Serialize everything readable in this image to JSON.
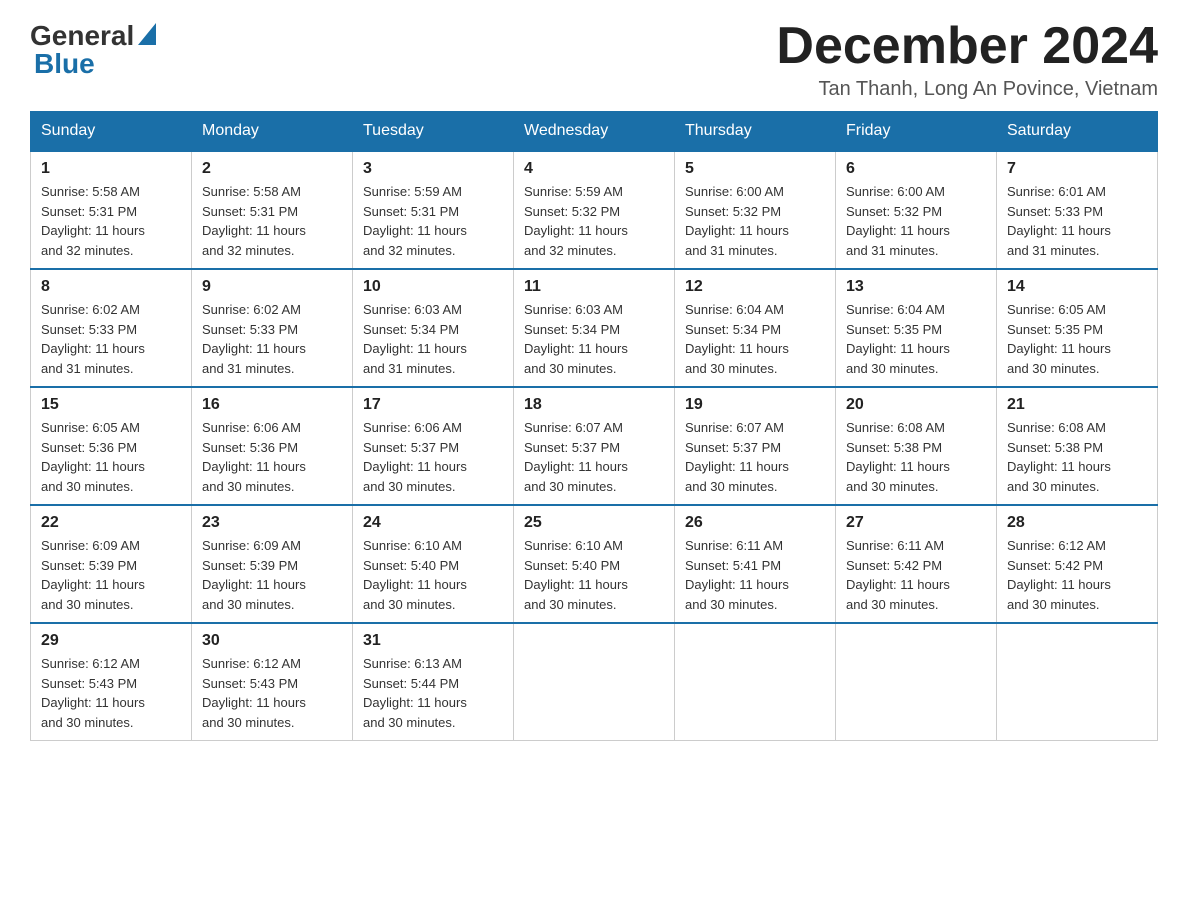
{
  "header": {
    "logo_general": "General",
    "logo_blue": "Blue",
    "month_title": "December 2024",
    "location": "Tan Thanh, Long An Povince, Vietnam"
  },
  "days_of_week": [
    "Sunday",
    "Monday",
    "Tuesday",
    "Wednesday",
    "Thursday",
    "Friday",
    "Saturday"
  ],
  "weeks": [
    [
      {
        "day": "1",
        "sunrise": "5:58 AM",
        "sunset": "5:31 PM",
        "daylight": "11 hours and 32 minutes."
      },
      {
        "day": "2",
        "sunrise": "5:58 AM",
        "sunset": "5:31 PM",
        "daylight": "11 hours and 32 minutes."
      },
      {
        "day": "3",
        "sunrise": "5:59 AM",
        "sunset": "5:31 PM",
        "daylight": "11 hours and 32 minutes."
      },
      {
        "day": "4",
        "sunrise": "5:59 AM",
        "sunset": "5:32 PM",
        "daylight": "11 hours and 32 minutes."
      },
      {
        "day": "5",
        "sunrise": "6:00 AM",
        "sunset": "5:32 PM",
        "daylight": "11 hours and 31 minutes."
      },
      {
        "day": "6",
        "sunrise": "6:00 AM",
        "sunset": "5:32 PM",
        "daylight": "11 hours and 31 minutes."
      },
      {
        "day": "7",
        "sunrise": "6:01 AM",
        "sunset": "5:33 PM",
        "daylight": "11 hours and 31 minutes."
      }
    ],
    [
      {
        "day": "8",
        "sunrise": "6:02 AM",
        "sunset": "5:33 PM",
        "daylight": "11 hours and 31 minutes."
      },
      {
        "day": "9",
        "sunrise": "6:02 AM",
        "sunset": "5:33 PM",
        "daylight": "11 hours and 31 minutes."
      },
      {
        "day": "10",
        "sunrise": "6:03 AM",
        "sunset": "5:34 PM",
        "daylight": "11 hours and 31 minutes."
      },
      {
        "day": "11",
        "sunrise": "6:03 AM",
        "sunset": "5:34 PM",
        "daylight": "11 hours and 30 minutes."
      },
      {
        "day": "12",
        "sunrise": "6:04 AM",
        "sunset": "5:34 PM",
        "daylight": "11 hours and 30 minutes."
      },
      {
        "day": "13",
        "sunrise": "6:04 AM",
        "sunset": "5:35 PM",
        "daylight": "11 hours and 30 minutes."
      },
      {
        "day": "14",
        "sunrise": "6:05 AM",
        "sunset": "5:35 PM",
        "daylight": "11 hours and 30 minutes."
      }
    ],
    [
      {
        "day": "15",
        "sunrise": "6:05 AM",
        "sunset": "5:36 PM",
        "daylight": "11 hours and 30 minutes."
      },
      {
        "day": "16",
        "sunrise": "6:06 AM",
        "sunset": "5:36 PM",
        "daylight": "11 hours and 30 minutes."
      },
      {
        "day": "17",
        "sunrise": "6:06 AM",
        "sunset": "5:37 PM",
        "daylight": "11 hours and 30 minutes."
      },
      {
        "day": "18",
        "sunrise": "6:07 AM",
        "sunset": "5:37 PM",
        "daylight": "11 hours and 30 minutes."
      },
      {
        "day": "19",
        "sunrise": "6:07 AM",
        "sunset": "5:37 PM",
        "daylight": "11 hours and 30 minutes."
      },
      {
        "day": "20",
        "sunrise": "6:08 AM",
        "sunset": "5:38 PM",
        "daylight": "11 hours and 30 minutes."
      },
      {
        "day": "21",
        "sunrise": "6:08 AM",
        "sunset": "5:38 PM",
        "daylight": "11 hours and 30 minutes."
      }
    ],
    [
      {
        "day": "22",
        "sunrise": "6:09 AM",
        "sunset": "5:39 PM",
        "daylight": "11 hours and 30 minutes."
      },
      {
        "day": "23",
        "sunrise": "6:09 AM",
        "sunset": "5:39 PM",
        "daylight": "11 hours and 30 minutes."
      },
      {
        "day": "24",
        "sunrise": "6:10 AM",
        "sunset": "5:40 PM",
        "daylight": "11 hours and 30 minutes."
      },
      {
        "day": "25",
        "sunrise": "6:10 AM",
        "sunset": "5:40 PM",
        "daylight": "11 hours and 30 minutes."
      },
      {
        "day": "26",
        "sunrise": "6:11 AM",
        "sunset": "5:41 PM",
        "daylight": "11 hours and 30 minutes."
      },
      {
        "day": "27",
        "sunrise": "6:11 AM",
        "sunset": "5:42 PM",
        "daylight": "11 hours and 30 minutes."
      },
      {
        "day": "28",
        "sunrise": "6:12 AM",
        "sunset": "5:42 PM",
        "daylight": "11 hours and 30 minutes."
      }
    ],
    [
      {
        "day": "29",
        "sunrise": "6:12 AM",
        "sunset": "5:43 PM",
        "daylight": "11 hours and 30 minutes."
      },
      {
        "day": "30",
        "sunrise": "6:12 AM",
        "sunset": "5:43 PM",
        "daylight": "11 hours and 30 minutes."
      },
      {
        "day": "31",
        "sunrise": "6:13 AM",
        "sunset": "5:44 PM",
        "daylight": "11 hours and 30 minutes."
      },
      null,
      null,
      null,
      null
    ]
  ],
  "labels": {
    "sunrise": "Sunrise:",
    "sunset": "Sunset:",
    "daylight": "Daylight:"
  }
}
